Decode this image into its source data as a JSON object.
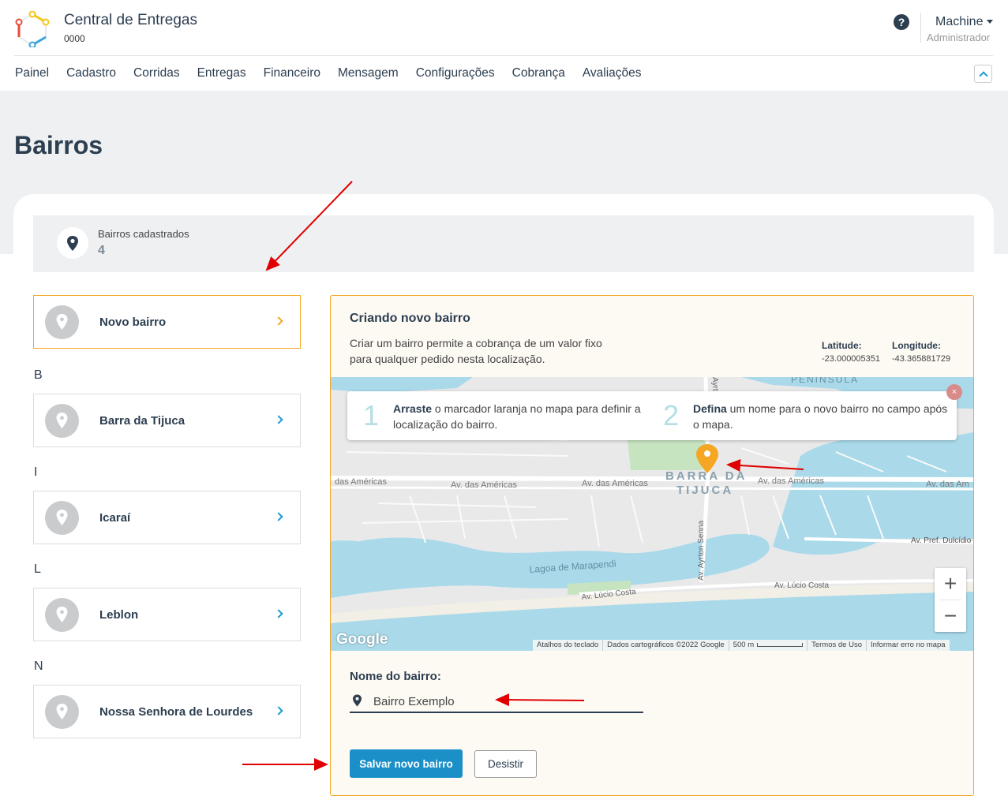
{
  "header": {
    "app_title": "Central de Entregas",
    "app_code": "0000",
    "help_icon": "?",
    "user_name": "Machine",
    "user_role": "Administrador"
  },
  "nav": [
    "Painel",
    "Cadastro",
    "Corridas",
    "Entregas",
    "Financeiro",
    "Mensagem",
    "Configurações",
    "Cobrança",
    "Avaliações"
  ],
  "page": {
    "title": "Bairros"
  },
  "stats": {
    "label": "Bairros cadastrados",
    "value": "4"
  },
  "list": {
    "new_item": "Novo bairro",
    "groups": [
      {
        "letter": "B",
        "item": "Barra da Tijuca"
      },
      {
        "letter": "I",
        "item": "Icaraí"
      },
      {
        "letter": "L",
        "item": "Leblon"
      },
      {
        "letter": "N",
        "item": "Nossa Senhora de Lourdes"
      }
    ]
  },
  "panel": {
    "title": "Criando novo bairro",
    "description": "Criar um bairro permite a cobrança de um valor fixo para qualquer pedido nesta localização.",
    "latitude_label": "Latitude:",
    "latitude_value": "-23.000005351",
    "longitude_label": "Longitude:",
    "longitude_value": "-43.365881729",
    "tip1_num": "1",
    "tip1_bold": "Arraste",
    "tip1_text": " o marcador laranja no mapa para definir a localização do bairro.",
    "tip2_num": "2",
    "tip2_bold": "Defina",
    "tip2_text": " um nome para o novo bairro no campo após o mapa.",
    "tip_close": "×",
    "map": {
      "labels": {
        "peninsula": "PENÍNSULA",
        "barra1": "BARRA DA",
        "barra2": "TIJUCA",
        "americas1": "das Américas",
        "americas2": "Av. das Américas",
        "americas3": "Av. das Américas",
        "americas4": "Av. das Américas",
        "americas5": "Av. das Am",
        "lagoa": "Lagoa de Marapendi",
        "lucio1": "Av. Lúcio Costa",
        "lucio2": "Av. Lúcio Costa",
        "senna": "Av. Ayrton Senna",
        "dulcidio": "Av. Pref. Dulcídio",
        "ayrt_top": "Ayrt"
      },
      "google": "Google",
      "zoom_in": "+",
      "zoom_out": "−",
      "attrib_keyboard": "Atalhos do teclado",
      "attrib_data": "Dados cartográficos ©2022 Google",
      "attrib_scale": "500 m",
      "attrib_terms": "Termos de Uso",
      "attrib_report": "Informar erro no mapa"
    },
    "name_label": "Nome do bairro:",
    "name_value": "Bairro Exemplo",
    "save_button": "Salvar novo bairro",
    "cancel_button": "Desistir"
  },
  "colors": {
    "accent": "#1b8fc7",
    "highlight": "#f5a623",
    "annotation_arrow": "#e00000"
  }
}
